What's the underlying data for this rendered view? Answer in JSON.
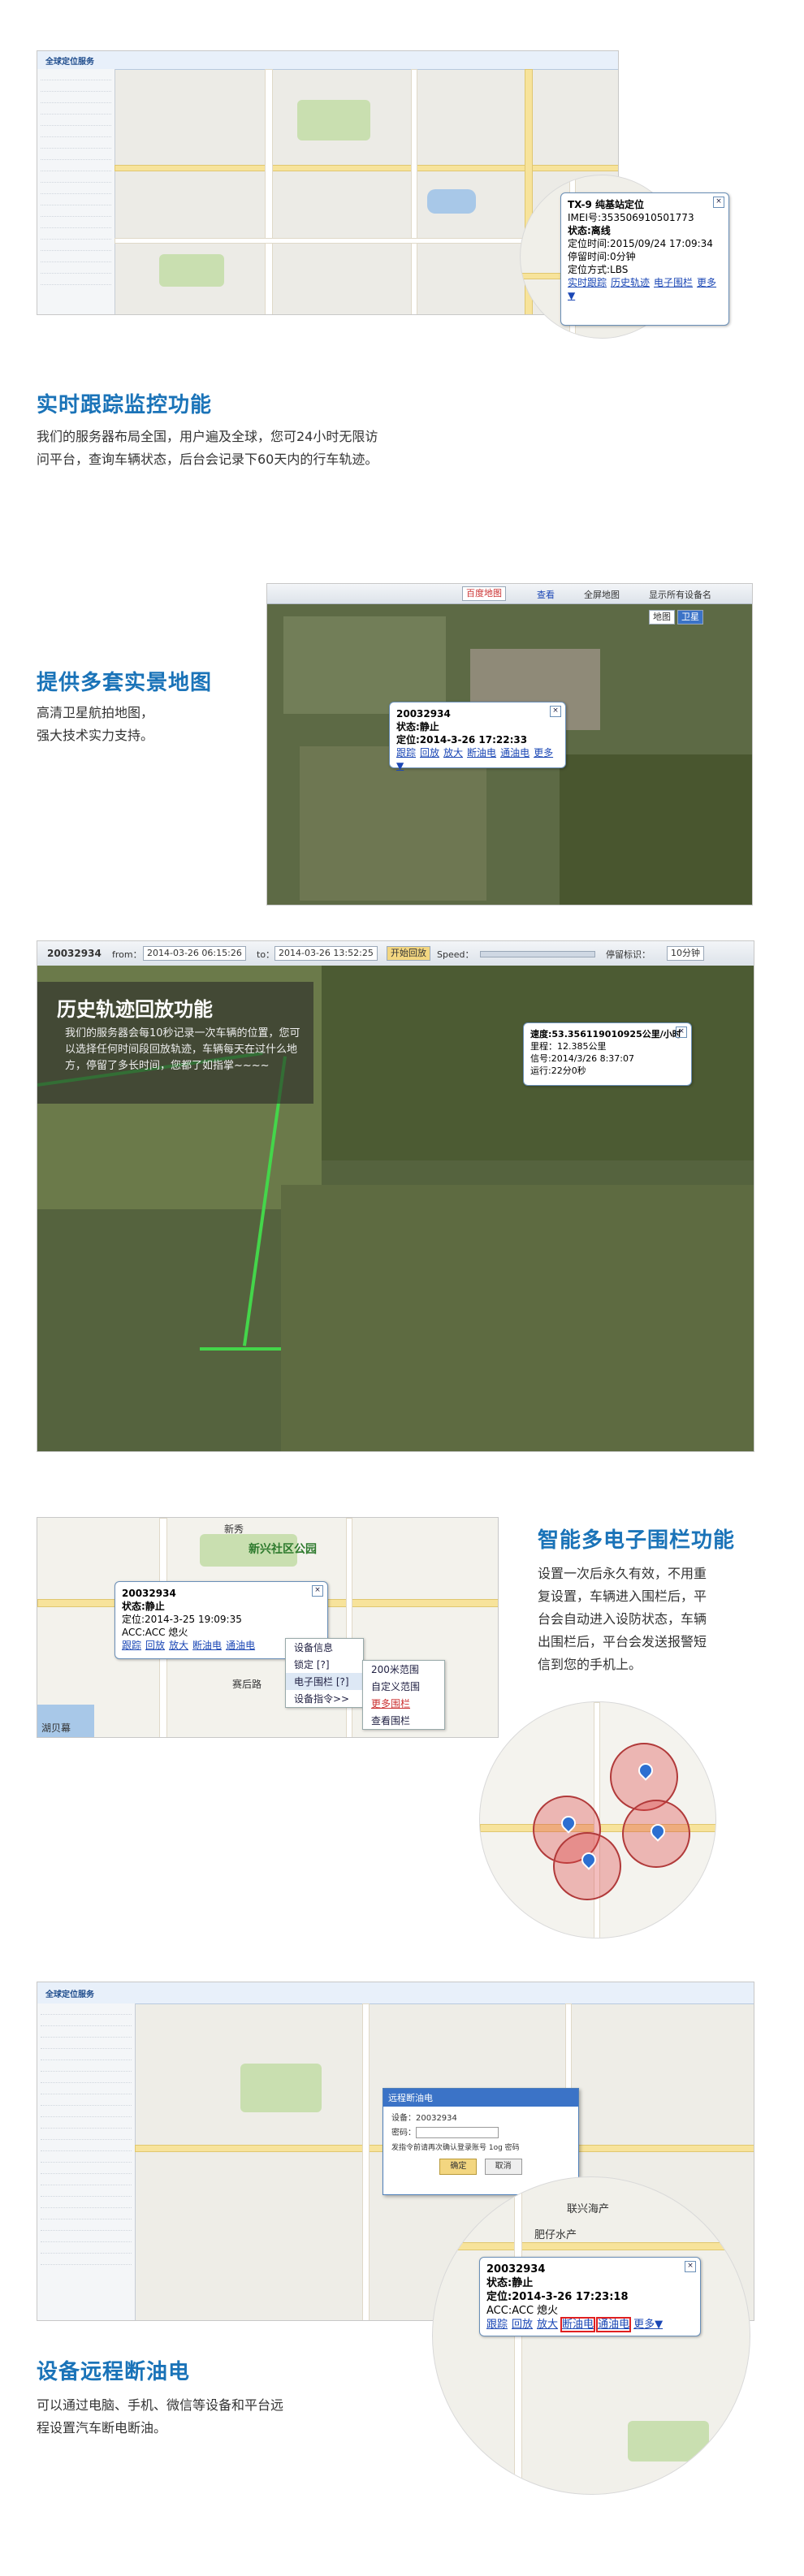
{
  "section1": {
    "heading": "实时跟踪监控功能",
    "desc_line1": "我们的服务器布局全国，用户遍及全球，您可24小时无限访",
    "desc_line2": "问平台，查询车辆状态，后台会记录下60天内的行车轨迹。",
    "app_title": "全球定位服务",
    "popup": {
      "title": "TX-9 纯基站定位",
      "imei": "IMEI号:353506910501773",
      "status": "状态:离线",
      "loc_time": "定位时间:2015/09/24 17:09:34",
      "stay": "停留时间:0分钟",
      "mode": "定位方式:LBS",
      "links": [
        "实时跟踪",
        "历史轨迹",
        "电子围栏",
        "更多▼"
      ]
    }
  },
  "section2": {
    "heading": "提供多套实景地图",
    "desc_line1": "高清卫星航拍地图，",
    "desc_line2": "强大技术实力支持。",
    "map_select": "百度地图",
    "toolbar_items": [
      "查看",
      "全屏地图",
      "显示所有设备名"
    ],
    "map_types": [
      "地图",
      "卫星"
    ],
    "popup": {
      "title": "20032934",
      "status": "状态:静止",
      "loc": "定位:2014-3-26 17:22:33",
      "links": [
        "跟踪",
        "回放",
        "放大",
        "断油电",
        "通油电",
        "更多▼"
      ]
    }
  },
  "section3": {
    "heading": "历史轨迹回放功能",
    "desc": "我们的服务器会每10秒记录一次车辆的位置，您可以选择任何时间段回放轨迹，车辆每天在过什么地方，停留了多长时间，您都了如指掌~~~~",
    "device": "20032934",
    "from_label": "from：",
    "from_value": "2014-03-26 06:15:26",
    "to_label": "to：",
    "to_value": "2014-03-26 13:52:25",
    "play_button": "开始回放",
    "speed_label": "Speed：",
    "stop_label": "停留标识：",
    "stop_value": "10分钟",
    "popup": {
      "speed": "速度:53.356119010925公里/小时",
      "mileage": "里程：12.385公里",
      "signal": "信号:2014/3/26 8:37:07",
      "run": "运行:22分0秒"
    }
  },
  "section4": {
    "heading": "智能多电子围栏功能",
    "desc": [
      "设置一次后永久有效，不用重",
      "复设置，车辆进入围栏后，平",
      "台会自动进入设防状态，车辆",
      "出围栏后，平台会发送报警短",
      "信到您的手机上。"
    ],
    "map_labels": [
      "新秀",
      "新兴社区公园",
      "赛后路",
      "湖贝幕"
    ],
    "popup": {
      "title": "20032934",
      "status": "状态:静止",
      "loc": "定位:2014-3-25 19:09:35",
      "acc": "ACC:ACC 熄火",
      "links": [
        "跟踪",
        "回放",
        "放大",
        "断油电",
        "通油电"
      ]
    },
    "menu1": [
      "设备信息",
      "锁定 [?]",
      "电子围栏 [?]",
      "设备指令>>"
    ],
    "menu2": [
      "200米范围",
      "自定义范围",
      "更多围栏",
      "查看围栏"
    ]
  },
  "section5": {
    "heading": "设备远程断油电",
    "desc_line1": "可以通过电脑、手机、微信等设备和平台远",
    "desc_line2": "程设置汽车断电断油。",
    "dialog_title": "远程断油电",
    "dialog_device_label": "设备：",
    "dialog_device": "20032934",
    "dialog_pwd_label": "密码：",
    "dialog_note": "发指令前请再次确认登录账号 1og 密码",
    "dialog_ok": "确定",
    "dialog_cancel": "取消",
    "map_labels": [
      "联兴海产",
      "肥仔水产"
    ],
    "popup": {
      "title": "20032934",
      "status": "状态:静止",
      "loc": "定位:2014-3-26 17:23:18",
      "acc": "ACC:ACC 熄火",
      "links": [
        "跟踪",
        "回放",
        "放大",
        "断油电",
        "通油电",
        "更多▼"
      ]
    }
  },
  "colors": {
    "heading": "#1a73b8",
    "track": "#44d64a",
    "fence": "#b13a3a"
  }
}
